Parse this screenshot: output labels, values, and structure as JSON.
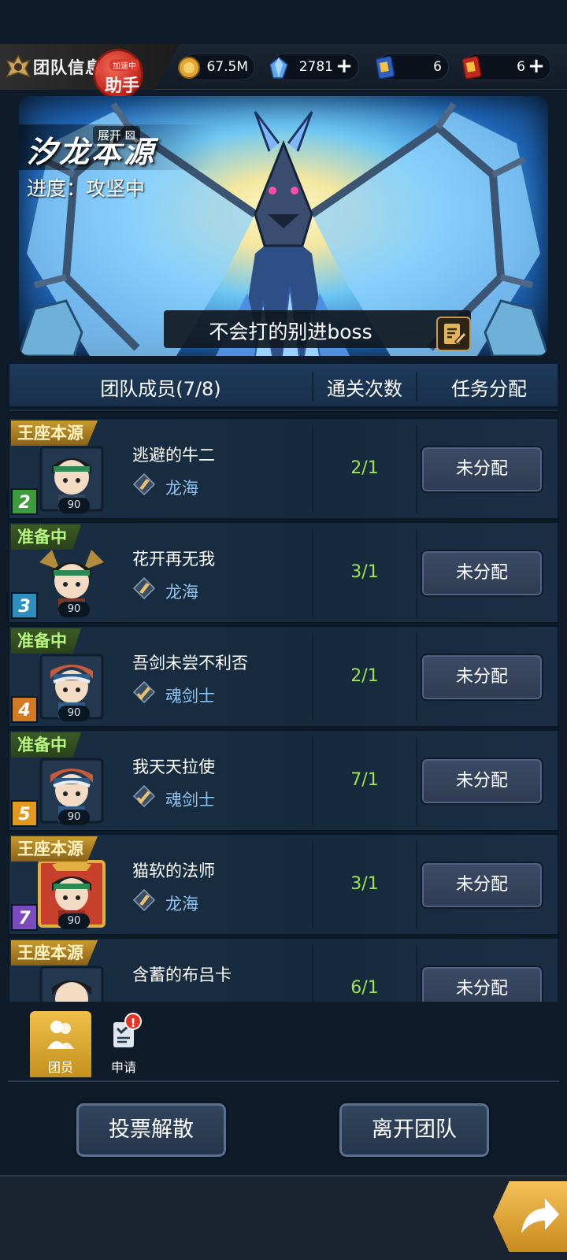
{
  "topbar": {
    "title": "团队信息",
    "helper_badge": "加速中",
    "helper_text": "助手",
    "currencies": [
      {
        "icon": "gold-coin-icon",
        "value": "67.5M",
        "has_plus": false
      },
      {
        "icon": "blue-crystal-icon",
        "value": "2781",
        "has_plus": true
      },
      {
        "icon": "blue-ticket-icon",
        "value": "6",
        "has_plus": false
      },
      {
        "icon": "red-gold-ticket-icon",
        "value": "6",
        "has_plus": true
      }
    ]
  },
  "banner": {
    "boss_name": "汐龙本源",
    "expand_label": "展开",
    "progress": "进度：攻坚中",
    "team_tag": "不会打的别进boss"
  },
  "table": {
    "header": {
      "members": "团队成员(7/8)",
      "clears": "通关次数",
      "task": "任务分配"
    },
    "rows": [
      {
        "status": "王座本源",
        "status_color": "gold",
        "level_rank": "2",
        "rank_color": "#3c9b3a",
        "level": "90",
        "name": "逃避的牛二",
        "class": "龙海",
        "clears": "2/1",
        "task": "未分配"
      },
      {
        "status": "准备中",
        "status_color": "green",
        "level_rank": "3",
        "rank_color": "#2d8fbd",
        "level": "90",
        "name": "花开再无我",
        "class": "龙海",
        "clears": "3/1",
        "task": "未分配"
      },
      {
        "status": "准备中",
        "status_color": "green",
        "level_rank": "4",
        "rank_color": "#d57a22",
        "level": "90",
        "name": "吾剑未尝不利否",
        "class": "魂剑士",
        "clears": "2/1",
        "task": "未分配"
      },
      {
        "status": "准备中",
        "status_color": "green",
        "level_rank": "5",
        "rank_color": "#e39a1c",
        "level": "90",
        "name": "我天天拉使",
        "class": "魂剑士",
        "clears": "7/1",
        "task": "未分配"
      },
      {
        "status": "王座本源",
        "status_color": "gold",
        "level_rank": "7",
        "rank_color": "#7a4bbf",
        "level": "90",
        "name": "猫软的法师",
        "class": "龙海",
        "clears": "3/1",
        "task": "未分配"
      },
      {
        "status": "王座本源",
        "status_color": "gold",
        "level_rank": "",
        "rank_color": "#7a4bbf",
        "level": "",
        "name": "含蓄的布吕卡",
        "class": "",
        "clears": "6/1",
        "task": "未分配"
      }
    ]
  },
  "tabs": [
    {
      "label": "团员",
      "icon": "members-icon",
      "active": true
    },
    {
      "label": "申请",
      "icon": "application-icon",
      "active": false
    }
  ],
  "tab_alert": "!",
  "buttons": {
    "vote_disband": "投票解散",
    "leave_team": "离开团队"
  }
}
